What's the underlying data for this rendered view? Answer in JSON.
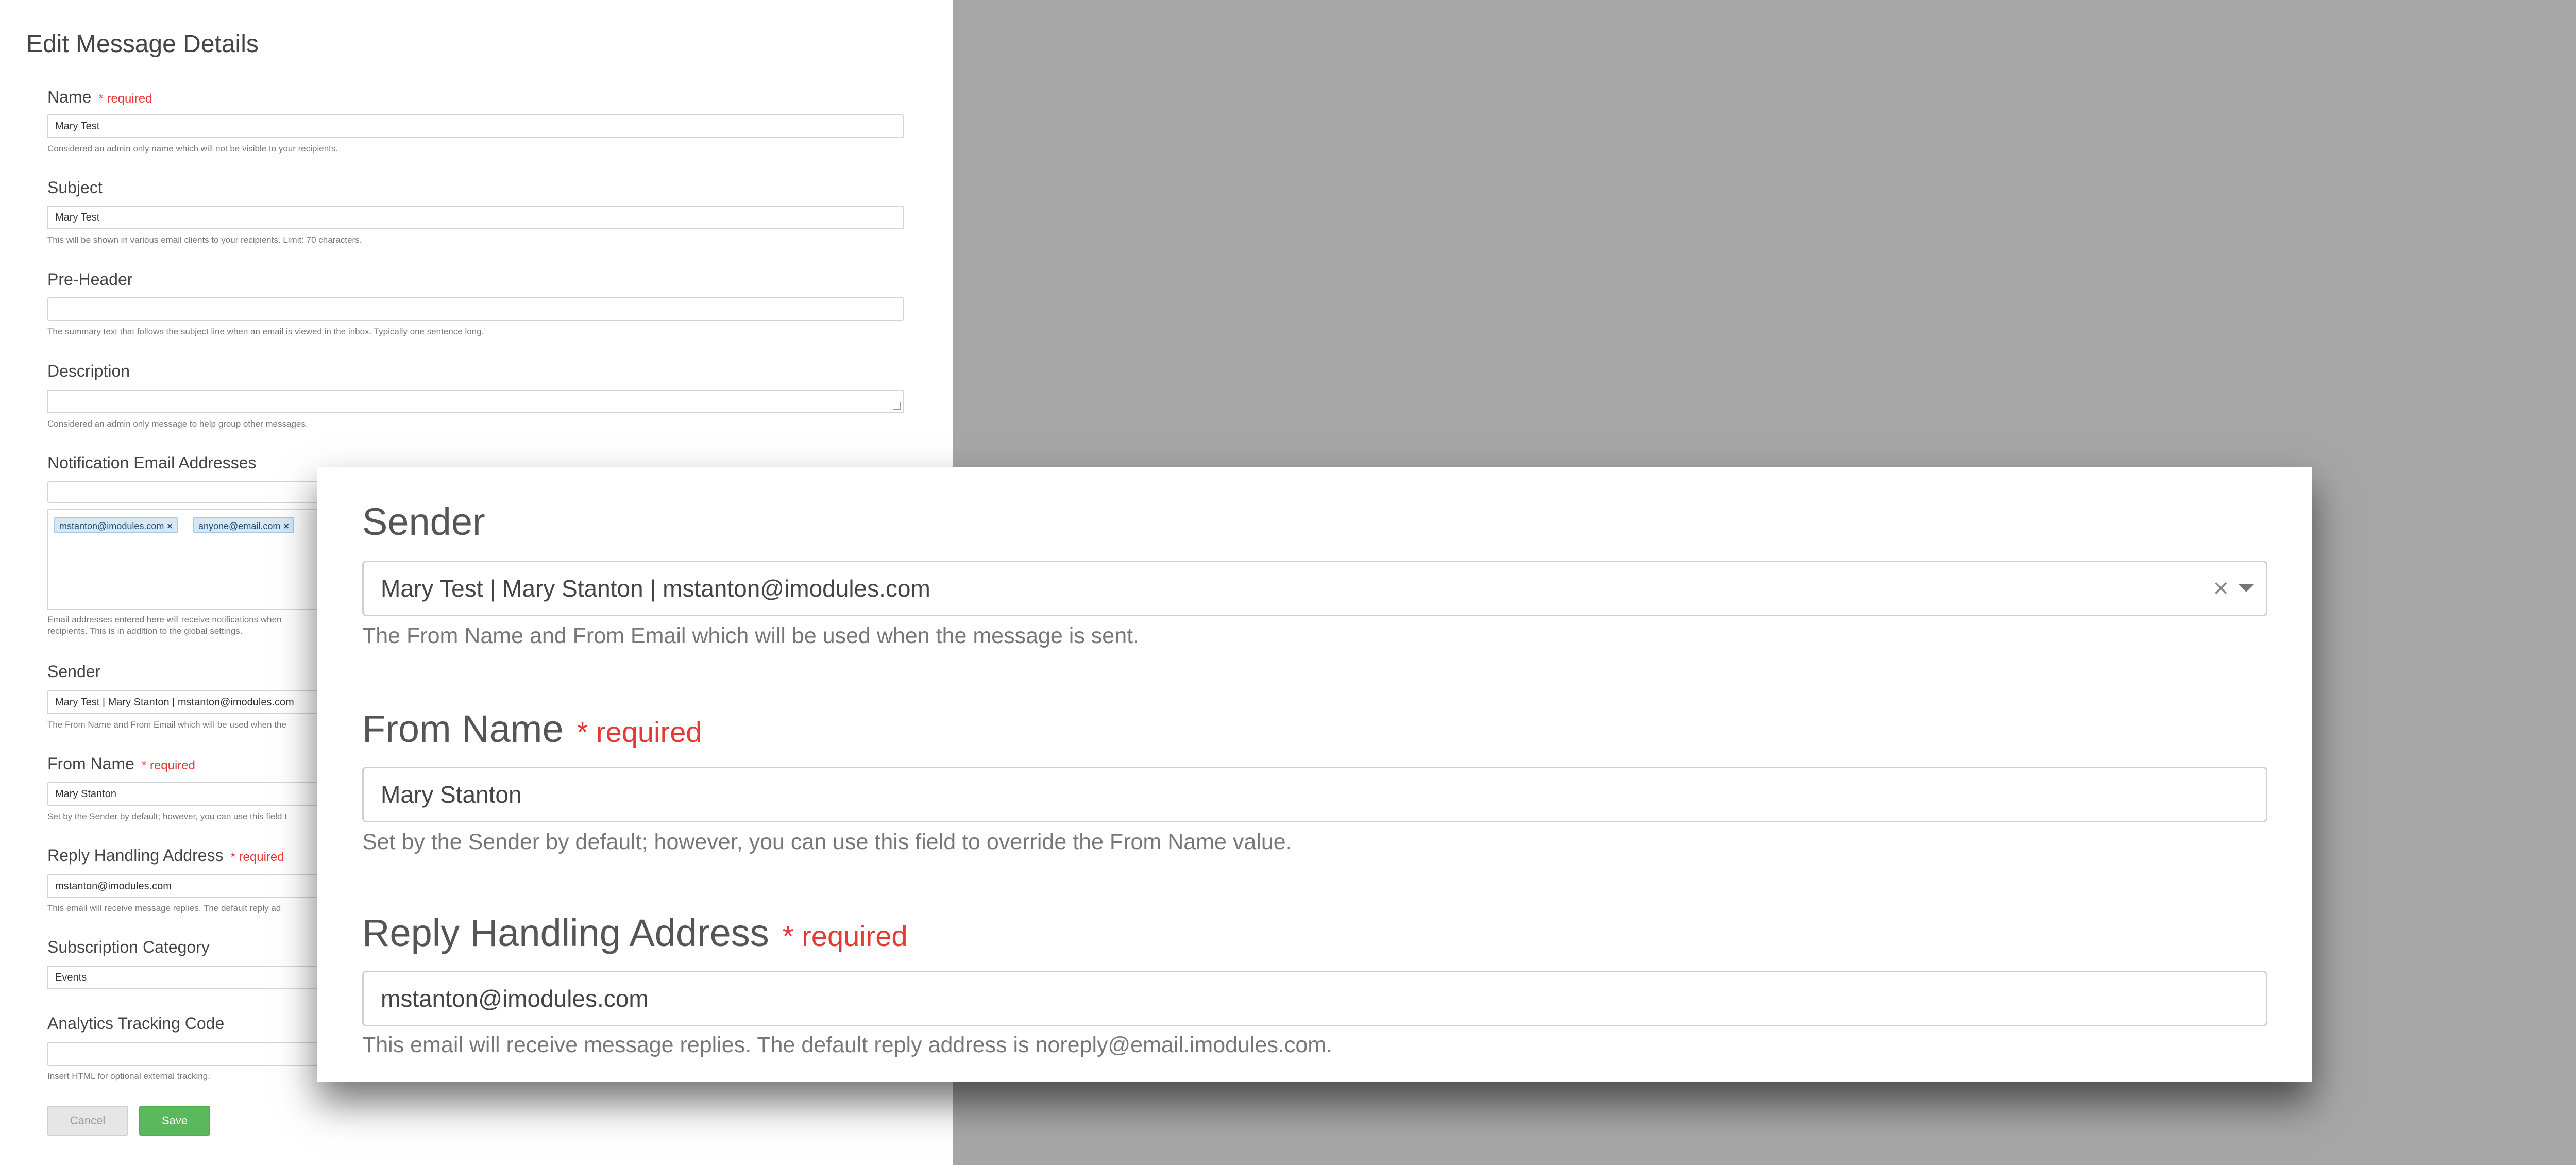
{
  "form": {
    "title": "Edit Message Details",
    "required_text": "* required",
    "name": {
      "label": "Name",
      "value": "Mary Test",
      "help": "Considered an admin only name which will not be visible to your recipients."
    },
    "subject": {
      "label": "Subject",
      "value": "Mary Test",
      "help": "This will be shown in various email clients to your recipients. Limit: 70 characters."
    },
    "preheader": {
      "label": "Pre-Header",
      "value": "",
      "help": "The summary text that follows the subject line when an email is viewed in the inbox. Typically one sentence long."
    },
    "description": {
      "label": "Description",
      "value": "",
      "help": "Considered an admin only message to help group other messages."
    },
    "notification": {
      "label": "Notification Email Addresses",
      "tags": [
        "mstanton@imodules.com",
        "anyone@email.com"
      ],
      "help_line1": "Email addresses entered here will receive notifications when",
      "help_line2": "recipients. This is in addition to the global settings."
    },
    "sender": {
      "label": "Sender",
      "value": "Mary Test | Mary Stanton | mstanton@imodules.com",
      "help": "The From Name and From Email which will be used when the"
    },
    "from_name": {
      "label": "From Name",
      "value": "Mary Stanton",
      "help": "Set by the Sender by default; however, you can use this field t"
    },
    "reply": {
      "label": "Reply Handling Address",
      "value": "mstanton@imodules.com",
      "help": "This email will receive message replies. The default reply ad"
    },
    "subscription": {
      "label": "Subscription Category",
      "value": "Events"
    },
    "analytics": {
      "label": "Analytics Tracking Code",
      "value": "",
      "help": "Insert HTML for optional external tracking."
    },
    "cancel_label": "Cancel",
    "save_label": "Save"
  },
  "zoom": {
    "sender_label": "Sender",
    "sender_value": "Mary Test | Mary Stanton | mstanton@imodules.com",
    "sender_help": "The From Name and From Email which will be used when the message is sent.",
    "from_name_label": "From Name",
    "required_text": "* required",
    "from_name_value": "Mary Stanton",
    "from_name_help": "Set by the Sender by default; however, you can use this field to override the From Name value.",
    "reply_label": "Reply Handling Address",
    "reply_value": "mstanton@imodules.com",
    "reply_help": "This email will receive message replies. The default reply address is noreply@email.imodules.com."
  },
  "icons": {
    "tag_remove": "close-icon",
    "clear": "close-icon",
    "dropdown": "chevron-down-icon"
  }
}
